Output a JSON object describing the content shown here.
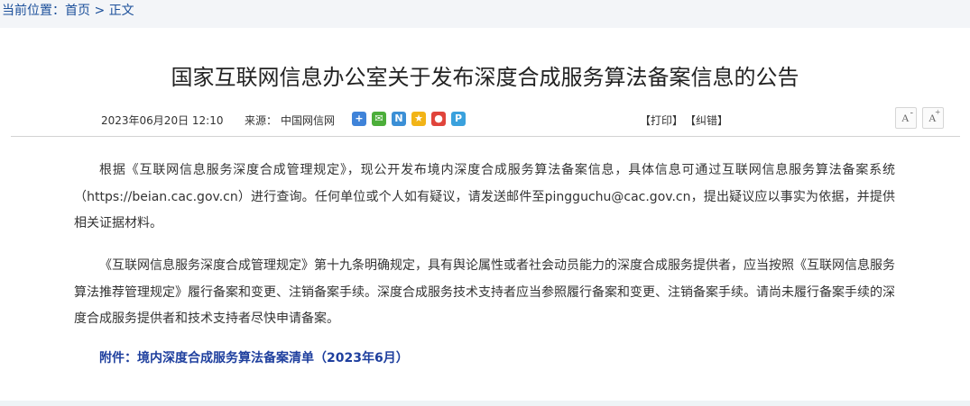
{
  "breadcrumb": {
    "label": "当前位置：",
    "home": "首页",
    "sep": " > ",
    "current": "正文"
  },
  "article": {
    "title": "国家互联网信息办公室关于发布深度合成服务算法备案信息的公告",
    "date": "2023年06月20日 12:10",
    "source_label": "来源：",
    "source": "中国网信网",
    "paragraphs": [
      "根据《互联网信息服务深度合成管理规定》，现公开发布境内深度合成服务算法备案信息，具体信息可通过互联网信息服务算法备案系统（https://beian.cac.gov.cn）进行查询。任何单位或个人如有疑议，请发送邮件至pingguchu@cac.gov.cn，提出疑议应以事实为依据，并提供相关证据材料。",
      "《互联网信息服务深度合成管理规定》第十九条明确规定，具有舆论属性或者社会动员能力的深度合成服务提供者，应当按照《互联网信息服务算法推荐管理规定》履行备案和变更、注销备案手续。深度合成服务技术支持者应当参照履行备案和变更、注销备案手续。请尚未履行备案手续的深度合成服务提供者和技术支持者尽快申请备案。"
    ],
    "attachment_label": "附件：",
    "attachment_title": "境内深度合成服务算法备案清单（2023年6月）"
  },
  "actions": {
    "print": "【打印】",
    "correct": "【纠错】"
  },
  "font_controls": {
    "letter": "A",
    "decrease_sign": "-",
    "increase_sign": "+"
  },
  "share_icons": [
    {
      "name": "share-plus-icon",
      "glyph": "+",
      "color": "#3f83d9"
    },
    {
      "name": "wechat-icon",
      "glyph": "✉",
      "color": "#4cae3a"
    },
    {
      "name": "share-n-icon",
      "glyph": "N",
      "color": "#3b8fd6"
    },
    {
      "name": "qzone-icon",
      "glyph": "★",
      "color": "#f2b417"
    },
    {
      "name": "weibo-icon",
      "glyph": "●",
      "color": "#e0443b"
    },
    {
      "name": "share-p-icon",
      "glyph": "P",
      "color": "#3aa1dd"
    }
  ]
}
